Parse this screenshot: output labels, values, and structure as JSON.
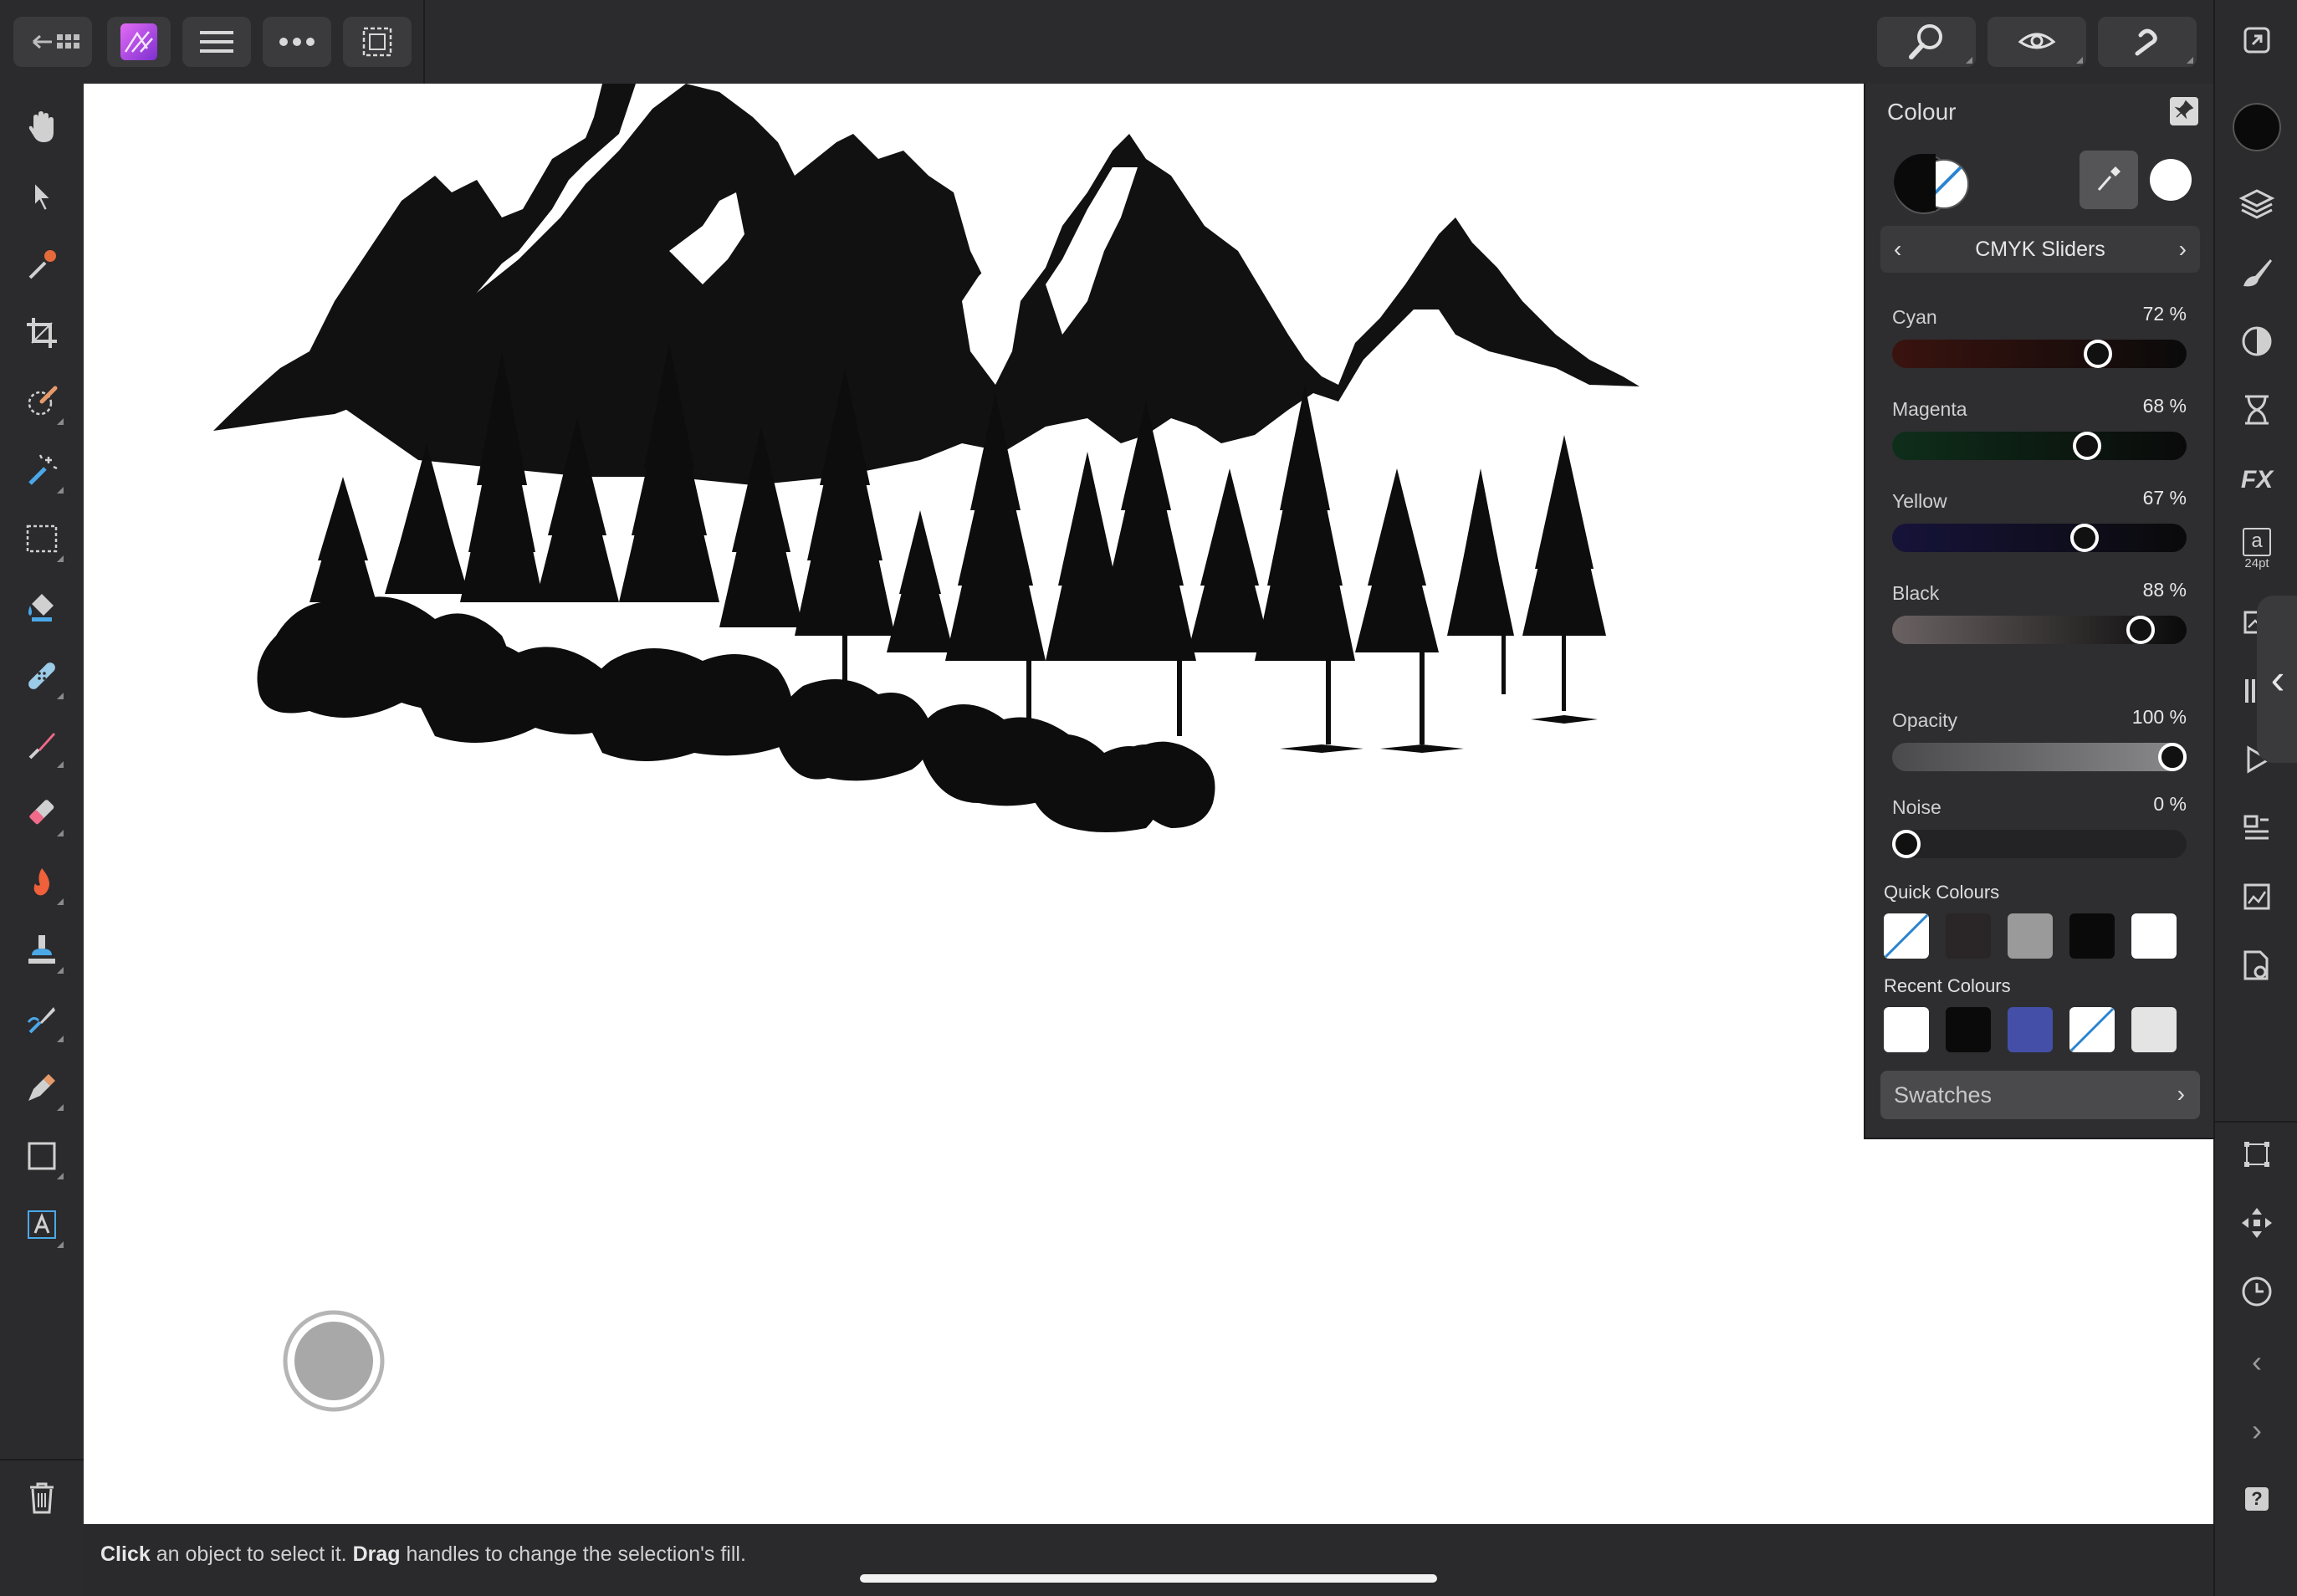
{
  "app": {
    "status": {
      "click_word": "Click",
      "click_rest": " an object to select it. ",
      "drag_word": "Drag",
      "drag_rest": " handles to change the selection's fill."
    }
  },
  "toolbar_icons": [
    "back-icon",
    "affinity-photo-logo",
    "menu-icon",
    "more-icon",
    "selection-mode-icon"
  ],
  "left_tools": [
    "hand-icon",
    "move-icon",
    "color-picker-icon",
    "crop-icon",
    "selection-brush-icon",
    "flood-select-icon",
    "marquee-icon",
    "fill-icon",
    "healing-icon",
    "paint-brush-icon",
    "erase-brush-icon",
    "burn-icon",
    "clone-stamp-icon",
    "smudge-icon",
    "pen-icon",
    "rectangle-icon",
    "artistic-text-icon"
  ],
  "right_strip_icons": [
    "layers-icon",
    "brushes-icon",
    "adjustments-icon",
    "history-icon",
    "fx-icon",
    "text-icon",
    "stock-icon",
    "channels-icon",
    "play-icon",
    "transform-icon",
    "navigator-icon"
  ],
  "text_style_label": "24pt",
  "colour_panel": {
    "title": "Colour",
    "mode": "CMYK Sliders",
    "sliders": [
      {
        "label": "Cyan",
        "value_text": "72 %",
        "value": 72
      },
      {
        "label": "Magenta",
        "value_text": "68 %",
        "value": 68
      },
      {
        "label": "Yellow",
        "value_text": "67 %",
        "value": 67
      },
      {
        "label": "Black",
        "value_text": "88 %",
        "value": 88
      },
      {
        "label": "Opacity",
        "value_text": "100 %",
        "value": 100
      },
      {
        "label": "Noise",
        "value_text": "0 %",
        "value": 0
      }
    ],
    "quick_colours_label": "Quick Colours",
    "quick_colours": [
      "none",
      "#2a2526",
      "#9a9a9a",
      "#0a0a0a",
      "#ffffff"
    ],
    "recent_colours_label": "Recent Colours",
    "recent_colours": [
      "#ffffff",
      "#0a0a0a",
      "#4450a8",
      "none",
      "#e4e4e4"
    ],
    "swatches_label": "Swatches"
  },
  "colors": {
    "accent_purple": "#b04fe0",
    "panel_bg": "#2e2e30",
    "canvas": "#ffffff"
  }
}
